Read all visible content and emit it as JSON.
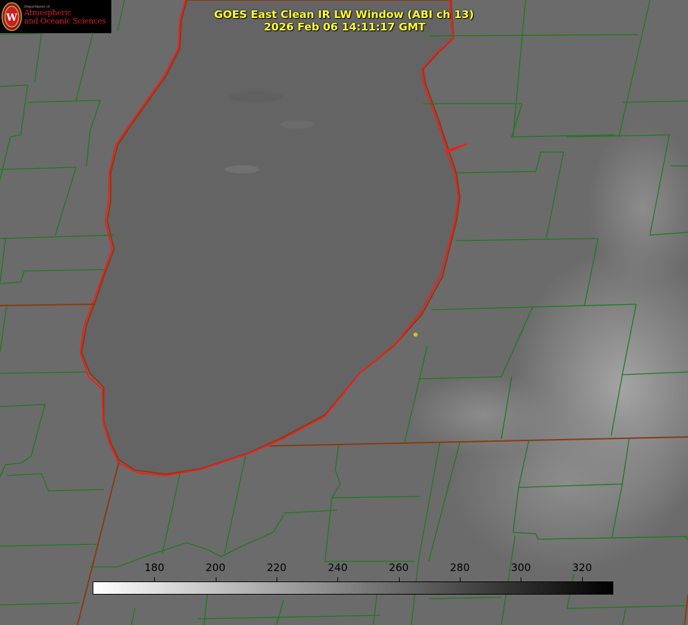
{
  "logo": {
    "department": "Department of",
    "line1": "Atmospheric",
    "line2": "and Oceanic Sciences",
    "seal_letter": "W"
  },
  "title": {
    "line1": "GOES East Clean IR LW Window (ABI ch 13)",
    "line2": "2026 Feb 06 14:11:17 GMT"
  },
  "colorbar": {
    "min": 160,
    "max": 330,
    "ticks": [
      "180",
      "200",
      "220",
      "240",
      "260",
      "280",
      "300",
      "320"
    ],
    "tick_values": [
      180,
      200,
      220,
      240,
      260,
      280,
      300,
      320
    ],
    "colors": {
      "low": "#ffffff",
      "high": "#000000"
    }
  },
  "colors": {
    "lake_outline": "#ee2020",
    "county_lines": "#1a7a1a",
    "state_lines": "#8a3a10",
    "marker": "#d8c800",
    "title": "#ffff33"
  }
}
